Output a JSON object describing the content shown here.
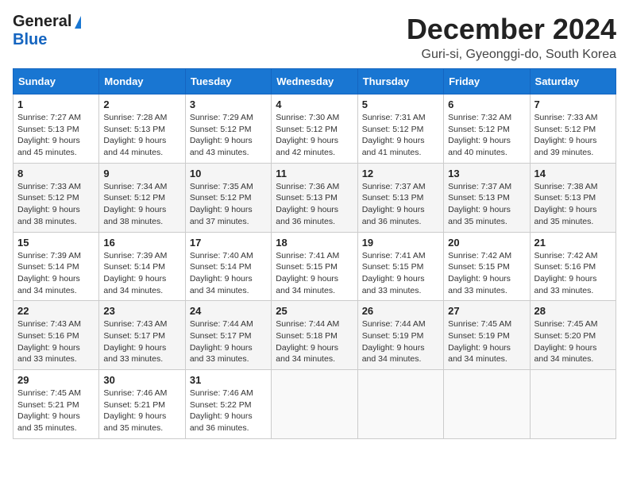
{
  "logo": {
    "line1": "General",
    "line2": "Blue"
  },
  "title": "December 2024",
  "subtitle": "Guri-si, Gyeonggi-do, South Korea",
  "header_color": "#1976d2",
  "days_of_week": [
    "Sunday",
    "Monday",
    "Tuesday",
    "Wednesday",
    "Thursday",
    "Friday",
    "Saturday"
  ],
  "weeks": [
    [
      {
        "day": 1,
        "sunrise": "Sunrise: 7:27 AM",
        "sunset": "Sunset: 5:13 PM",
        "daylight": "Daylight: 9 hours and 45 minutes."
      },
      {
        "day": 2,
        "sunrise": "Sunrise: 7:28 AM",
        "sunset": "Sunset: 5:13 PM",
        "daylight": "Daylight: 9 hours and 44 minutes."
      },
      {
        "day": 3,
        "sunrise": "Sunrise: 7:29 AM",
        "sunset": "Sunset: 5:12 PM",
        "daylight": "Daylight: 9 hours and 43 minutes."
      },
      {
        "day": 4,
        "sunrise": "Sunrise: 7:30 AM",
        "sunset": "Sunset: 5:12 PM",
        "daylight": "Daylight: 9 hours and 42 minutes."
      },
      {
        "day": 5,
        "sunrise": "Sunrise: 7:31 AM",
        "sunset": "Sunset: 5:12 PM",
        "daylight": "Daylight: 9 hours and 41 minutes."
      },
      {
        "day": 6,
        "sunrise": "Sunrise: 7:32 AM",
        "sunset": "Sunset: 5:12 PM",
        "daylight": "Daylight: 9 hours and 40 minutes."
      },
      {
        "day": 7,
        "sunrise": "Sunrise: 7:33 AM",
        "sunset": "Sunset: 5:12 PM",
        "daylight": "Daylight: 9 hours and 39 minutes."
      }
    ],
    [
      {
        "day": 8,
        "sunrise": "Sunrise: 7:33 AM",
        "sunset": "Sunset: 5:12 PM",
        "daylight": "Daylight: 9 hours and 38 minutes."
      },
      {
        "day": 9,
        "sunrise": "Sunrise: 7:34 AM",
        "sunset": "Sunset: 5:12 PM",
        "daylight": "Daylight: 9 hours and 38 minutes."
      },
      {
        "day": 10,
        "sunrise": "Sunrise: 7:35 AM",
        "sunset": "Sunset: 5:12 PM",
        "daylight": "Daylight: 9 hours and 37 minutes."
      },
      {
        "day": 11,
        "sunrise": "Sunrise: 7:36 AM",
        "sunset": "Sunset: 5:13 PM",
        "daylight": "Daylight: 9 hours and 36 minutes."
      },
      {
        "day": 12,
        "sunrise": "Sunrise: 7:37 AM",
        "sunset": "Sunset: 5:13 PM",
        "daylight": "Daylight: 9 hours and 36 minutes."
      },
      {
        "day": 13,
        "sunrise": "Sunrise: 7:37 AM",
        "sunset": "Sunset: 5:13 PM",
        "daylight": "Daylight: 9 hours and 35 minutes."
      },
      {
        "day": 14,
        "sunrise": "Sunrise: 7:38 AM",
        "sunset": "Sunset: 5:13 PM",
        "daylight": "Daylight: 9 hours and 35 minutes."
      }
    ],
    [
      {
        "day": 15,
        "sunrise": "Sunrise: 7:39 AM",
        "sunset": "Sunset: 5:14 PM",
        "daylight": "Daylight: 9 hours and 34 minutes."
      },
      {
        "day": 16,
        "sunrise": "Sunrise: 7:39 AM",
        "sunset": "Sunset: 5:14 PM",
        "daylight": "Daylight: 9 hours and 34 minutes."
      },
      {
        "day": 17,
        "sunrise": "Sunrise: 7:40 AM",
        "sunset": "Sunset: 5:14 PM",
        "daylight": "Daylight: 9 hours and 34 minutes."
      },
      {
        "day": 18,
        "sunrise": "Sunrise: 7:41 AM",
        "sunset": "Sunset: 5:15 PM",
        "daylight": "Daylight: 9 hours and 34 minutes."
      },
      {
        "day": 19,
        "sunrise": "Sunrise: 7:41 AM",
        "sunset": "Sunset: 5:15 PM",
        "daylight": "Daylight: 9 hours and 33 minutes."
      },
      {
        "day": 20,
        "sunrise": "Sunrise: 7:42 AM",
        "sunset": "Sunset: 5:15 PM",
        "daylight": "Daylight: 9 hours and 33 minutes."
      },
      {
        "day": 21,
        "sunrise": "Sunrise: 7:42 AM",
        "sunset": "Sunset: 5:16 PM",
        "daylight": "Daylight: 9 hours and 33 minutes."
      }
    ],
    [
      {
        "day": 22,
        "sunrise": "Sunrise: 7:43 AM",
        "sunset": "Sunset: 5:16 PM",
        "daylight": "Daylight: 9 hours and 33 minutes."
      },
      {
        "day": 23,
        "sunrise": "Sunrise: 7:43 AM",
        "sunset": "Sunset: 5:17 PM",
        "daylight": "Daylight: 9 hours and 33 minutes."
      },
      {
        "day": 24,
        "sunrise": "Sunrise: 7:44 AM",
        "sunset": "Sunset: 5:17 PM",
        "daylight": "Daylight: 9 hours and 33 minutes."
      },
      {
        "day": 25,
        "sunrise": "Sunrise: 7:44 AM",
        "sunset": "Sunset: 5:18 PM",
        "daylight": "Daylight: 9 hours and 34 minutes."
      },
      {
        "day": 26,
        "sunrise": "Sunrise: 7:44 AM",
        "sunset": "Sunset: 5:19 PM",
        "daylight": "Daylight: 9 hours and 34 minutes."
      },
      {
        "day": 27,
        "sunrise": "Sunrise: 7:45 AM",
        "sunset": "Sunset: 5:19 PM",
        "daylight": "Daylight: 9 hours and 34 minutes."
      },
      {
        "day": 28,
        "sunrise": "Sunrise: 7:45 AM",
        "sunset": "Sunset: 5:20 PM",
        "daylight": "Daylight: 9 hours and 34 minutes."
      }
    ],
    [
      {
        "day": 29,
        "sunrise": "Sunrise: 7:45 AM",
        "sunset": "Sunset: 5:21 PM",
        "daylight": "Daylight: 9 hours and 35 minutes."
      },
      {
        "day": 30,
        "sunrise": "Sunrise: 7:46 AM",
        "sunset": "Sunset: 5:21 PM",
        "daylight": "Daylight: 9 hours and 35 minutes."
      },
      {
        "day": 31,
        "sunrise": "Sunrise: 7:46 AM",
        "sunset": "Sunset: 5:22 PM",
        "daylight": "Daylight: 9 hours and 36 minutes."
      },
      null,
      null,
      null,
      null
    ]
  ]
}
